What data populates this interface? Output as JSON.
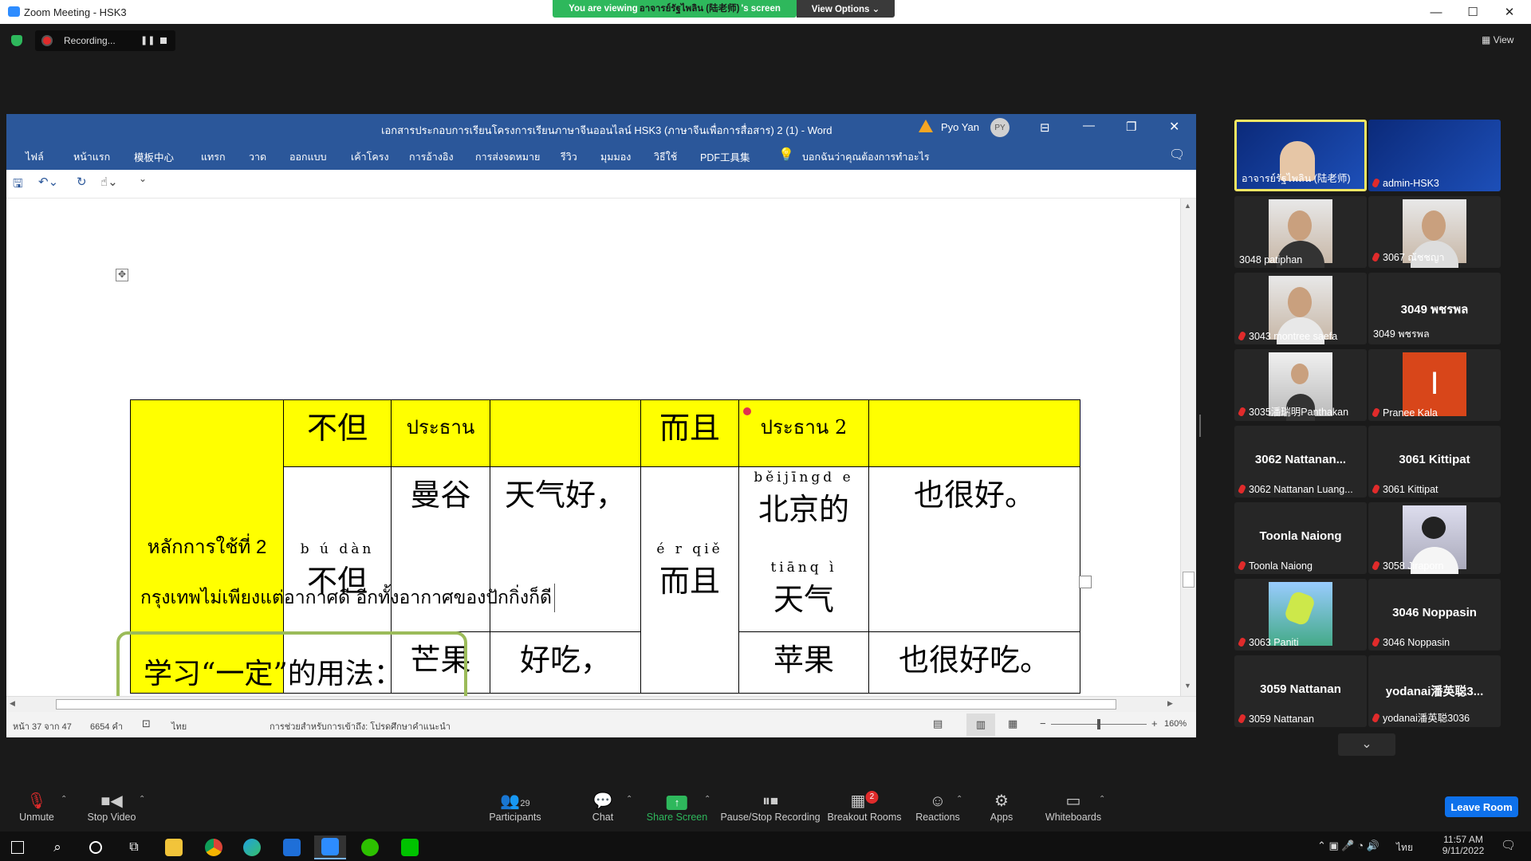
{
  "window": {
    "title": "Zoom Meeting - HSK3"
  },
  "share_banner": {
    "prefix": "You are viewing ",
    "presenter": "อาจารย์รัฐไพลิน (陆老师)",
    "suffix": "'s screen",
    "view_options": "View Options ⌄"
  },
  "recording": {
    "label": "Recording...",
    "pause": "❚❚"
  },
  "view_button": "▦ View",
  "word": {
    "title": "เอกสารประกอบการเรียนโครงการเรียนภาษาจีนออนไลน์ HSK3 (ภาษาจีนเพื่อการสื่อสาร) 2 (1)  -  Word",
    "user_name": "Pyo Yan",
    "user_initials": "PY",
    "ribbon_tabs": [
      "ไฟล์",
      "หน้าแรก",
      "模板中心",
      "แทรก",
      "วาด",
      "ออกแบบ",
      "เค้าโครง",
      "การอ้างอิง",
      "การส่งจดหมาย",
      "รีวิว",
      "มุมมอง",
      "วิธีใช้",
      "PDF工具集"
    ],
    "tell_me": "บอกฉันว่าคุณต้องการทำอะไร",
    "table": {
      "rule_label": "หลักการใช้ที่ 2",
      "header": [
        "不但",
        "ประธาน",
        "",
        "而且",
        "ประธาน 2",
        ""
      ],
      "budan_pinyin": "b ú dàn",
      "budan": "不但",
      "erqie_pinyin": "é r qiě",
      "erqie": "而且",
      "row1": {
        "subject": "曼谷",
        "predicate": "天气好，",
        "subject2_pinyin": "běijīngd e",
        "subject2": "北京的",
        "predicate2": "也很好。"
      },
      "tianqi_pinyin": "tiānq ì",
      "tianqi": "天气",
      "row2": {
        "subject": "芒果",
        "predicate": "好吃，",
        "subject2": "苹果",
        "predicate2": "也很好吃。"
      }
    },
    "sentence": "กรุงเทพไม่เพียงแต่อากาศดี อีกทั้งอากาศของปักกิ่งก็ดี",
    "box_text": "学习“一定”的用法：",
    "status": {
      "page": "หน้า 37 จาก 47",
      "words": "6654 คำ",
      "language": "ไทย",
      "accessibility": "การช่วยสำหรับการเข้าถึง: โปรดศึกษาคำแนะนำ",
      "zoom": "160%"
    }
  },
  "participants": [
    {
      "name": "อาจารย์รัฐไพลิน (陆老师)",
      "video": true,
      "active": true
    },
    {
      "name": "admin-HSK3",
      "video": true,
      "muted": true
    },
    {
      "name": "3048 patiphan",
      "video": true
    },
    {
      "name": "3067 ณัชชญา",
      "video": true,
      "muted": true
    },
    {
      "name": "3043 montree saefa",
      "video": true,
      "muted": true
    },
    {
      "name": "3049 พชรพล",
      "big": "3049 พชรพล"
    },
    {
      "name": "3035潘瑞明Panthakan",
      "video": true,
      "muted": true
    },
    {
      "name": "Pranee Kala",
      "initial": "I",
      "muted": true
    },
    {
      "name": "3062 Nattanan Luang...",
      "big": "3062 Nattanan...",
      "muted": true
    },
    {
      "name": "3061 Kittipat",
      "big": "3061 Kittipat",
      "muted": true
    },
    {
      "name": "Toonla Naiong",
      "big": "Toonla Naiong",
      "muted": true
    },
    {
      "name": "3058 Jiraporn",
      "video": true,
      "muted": true
    },
    {
      "name": "3063 Paniti",
      "video": true,
      "muted": true
    },
    {
      "name": "3046 Noppasin",
      "big": "3046 Noppasin",
      "muted": true
    },
    {
      "name": "3059 Nattanan",
      "big": "3059 Nattanan",
      "muted": true
    },
    {
      "name": "yodanai潘英聪3036",
      "big": "yodanai潘英聪3...",
      "muted": true
    }
  ],
  "toolbar": {
    "unmute": "Unmute",
    "stop_video": "Stop Video",
    "participants": "Participants",
    "participants_count": "29",
    "chat": "Chat",
    "share_screen": "Share Screen",
    "pause_recording": "Pause/Stop Recording",
    "breakout_rooms": "Breakout Rooms",
    "breakout_badge": "2",
    "reactions": "Reactions",
    "apps": "Apps",
    "whiteboards": "Whiteboards",
    "leave": "Leave Room"
  },
  "taskbar": {
    "time": "11:57 AM",
    "date": "9/11/2022",
    "lang": "ไทย"
  },
  "colors": {
    "word_blue": "#2b579a",
    "share_green": "#2eb85c",
    "leave_blue": "#0e71eb",
    "table_yellow": "#ffff00",
    "active_border": "#f5e663"
  }
}
